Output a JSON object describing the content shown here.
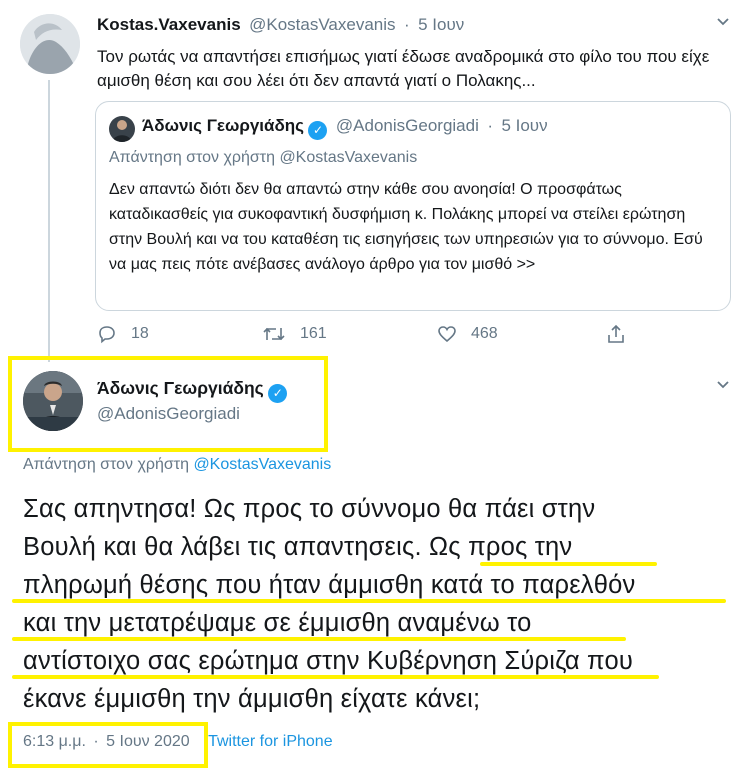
{
  "original_tweet": {
    "author_name": "Kostas.Vaxevanis",
    "author_handle": "@KostasVaxevanis",
    "separator": "·",
    "date": "5 Ιουν",
    "text": "Τον ρωτάς να απαντήσει επισήμως γιατί έδωσε αναδρομικά στο φίλο του που είχε αμισθη θέση και σου λέει ότι δεν απαντά γιατί ο Πολακης..."
  },
  "quoted_tweet": {
    "author_name": "Άδωνις Γεωργιάδης",
    "author_handle": "@AdonisGeorgiadi",
    "separator": "·",
    "date": "5 Ιουν",
    "reply_to_prefix": "Απάντηση στον χρήστη",
    "reply_to_handle": "@KostasVaxevanis",
    "text": "Δεν απαντώ διότι δεν θα απαντώ στην κάθε σου ανοησία! Ο προσφάτως καταδικασθείς για συκοφαντική δυσφήμιση κ. Πολάκης μπορεί να στείλει ερώτηση στην Βουλή και να του καταθέση τις εισηγήσεις των υπηρεσιών για το σύννομο. Εσύ να μας πεις πότε ανέβασες ανάλογο άρθρο για τον μισθό >>"
  },
  "actions": {
    "reply_count": "18",
    "retweet_count": "161",
    "like_count": "468"
  },
  "main_tweet": {
    "author_name": "Άδωνις Γεωργιάδης",
    "author_handle": "@AdonisGeorgiadi",
    "reply_to_prefix": "Απάντηση στον χρήστη",
    "reply_to_handle": "@KostasVaxevanis",
    "lines": [
      "Σας απηντησα! Ως προς το σύννομο θα πάει στην",
      "Βουλή και θα λάβει τις απαντησεις. Ως προς την",
      "πληρωμή θέσης που ήταν άμμισθη κατά το παρελθόν",
      "και την μετατρέψαμε σε έμμισθη αναμένω το",
      "αντίστοιχο σας ερώτημα στην Κυβέρνηση Σύριζα που",
      "έκανε έμμισθη την άμμισθη είχατε κάνει;"
    ],
    "time": "6:13 μ.μ.",
    "separator": "·",
    "date": "5 Ιουν 2020",
    "source": "Twitter for iPhone"
  },
  "colors": {
    "highlight": "#fff200",
    "link": "#1b95e0",
    "verified": "#1da1f2",
    "muted": "#657786"
  },
  "icons": {
    "verified": "✓",
    "chevron": "⌄"
  }
}
